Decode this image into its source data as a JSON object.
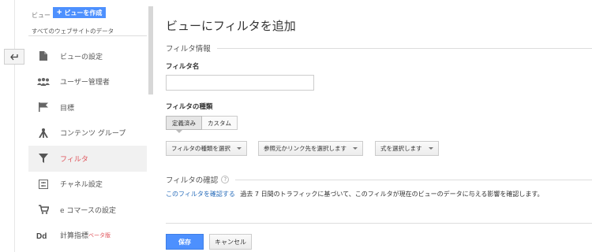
{
  "sidebar": {
    "view_label": "ビュー",
    "create_view_label": "ビューを作成",
    "view_name": "すべてのウェブサイトのデータ",
    "items": [
      {
        "label": "ビューの設定",
        "icon": "document-icon"
      },
      {
        "label": "ユーザー管理者",
        "icon": "users-icon"
      },
      {
        "label": "目標",
        "icon": "flag-icon"
      },
      {
        "label": "コンテンツ グループ",
        "icon": "content-group-icon"
      },
      {
        "label": "フィルタ",
        "icon": "filter-icon",
        "active": true
      },
      {
        "label": "チャネル設定",
        "icon": "channel-icon"
      },
      {
        "label": "e コマースの設定",
        "icon": "cart-icon"
      },
      {
        "label": "計算指標",
        "icon": "calculated-metrics-icon",
        "badge": "ベータ版"
      }
    ]
  },
  "main": {
    "title": "ビューにフィルタを追加",
    "filter_info_heading": "フィルタ情報",
    "filter_name_label": "フィルタ名",
    "filter_name_value": "",
    "filter_type_label": "フィルタの種類",
    "tab_predefined": "定義済み",
    "tab_custom": "カスタム",
    "dropdown_type": "フィルタの種類を選択",
    "dropdown_source": "参照元かリンク先を選択します",
    "dropdown_expression": "式を選択します",
    "verify_heading": "フィルタの確認",
    "verify_link": "このフィルタを確認する",
    "verify_text": "過去 7 日間のトラフィックに基づいて、このフィルタが現在のビューのデータに与える影響を確認します。",
    "save_label": "保存",
    "cancel_label": "キャンセル"
  },
  "colors": {
    "accent": "#4d90fe",
    "active_text": "#e0555c",
    "link": "#2a6ebb"
  }
}
